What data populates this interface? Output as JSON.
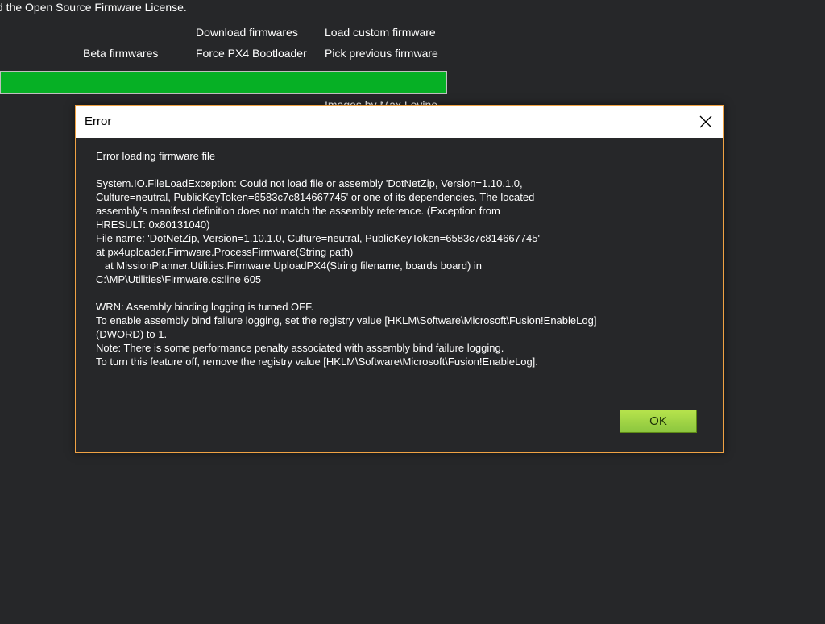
{
  "background": {
    "license_text": "d the Open Source Firmware License.",
    "links": {
      "download": "Download firmwares",
      "custom": "Load custom firmware",
      "beta": "Beta firmwares",
      "bootloader": "Force PX4 Bootloader",
      "previous": "Pick previous firmware"
    },
    "progress": {
      "value_percent": 100,
      "color": "#06b025"
    },
    "credit_text": "Images by Max Levine"
  },
  "dialog": {
    "title": "Error",
    "close_icon": "close-icon",
    "message": "Error loading firmware file\n\nSystem.IO.FileLoadException: Could not load file or assembly 'DotNetZip, Version=1.10.1.0,\nCulture=neutral, PublicKeyToken=6583c7c814667745' or one of its dependencies. The located\nassembly's manifest definition does not match the assembly reference. (Exception from\nHRESULT: 0x80131040)\nFile name: 'DotNetZip, Version=1.10.1.0, Culture=neutral, PublicKeyToken=6583c7c814667745'\nat px4uploader.Firmware.ProcessFirmware(String path)\n   at MissionPlanner.Utilities.Firmware.UploadPX4(String filename, boards board) in\nC:\\MP\\Utilities\\Firmware.cs:line 605\n\nWRN: Assembly binding logging is turned OFF.\nTo enable assembly bind failure logging, set the registry value [HKLM\\Software\\Microsoft\\Fusion!EnableLog]\n(DWORD) to 1.\nNote: There is some performance penalty associated with assembly bind failure logging.\nTo turn this feature off, remove the registry value [HKLM\\Software\\Microsoft\\Fusion!EnableLog].",
    "ok_label": "OK",
    "border_color": "#f0a244",
    "ok_color": "#a4d63f"
  }
}
